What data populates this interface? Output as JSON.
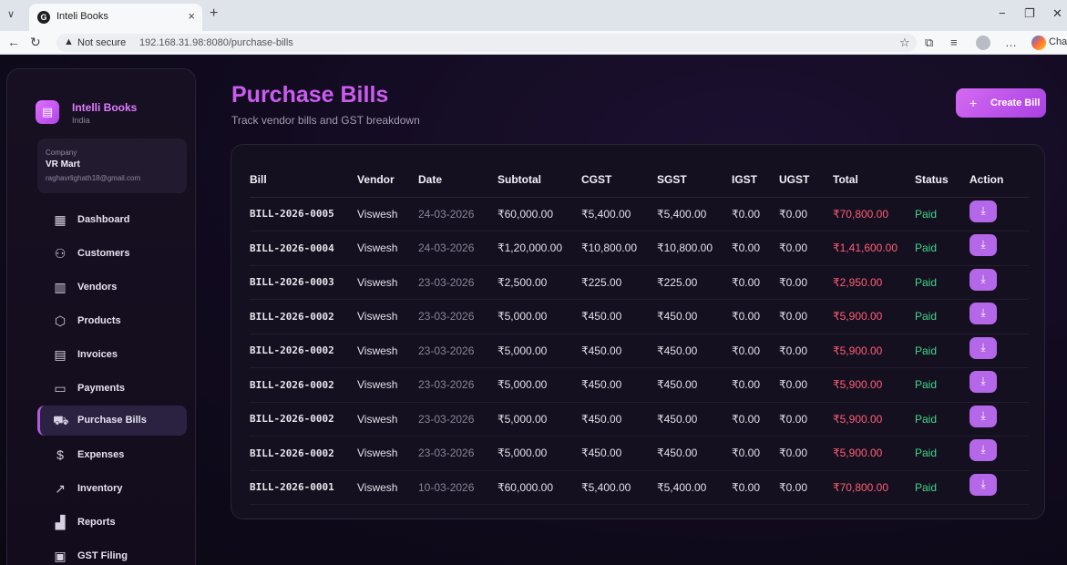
{
  "browser": {
    "tab_title": "Inteli Books",
    "tab_close": "×",
    "new_tab": "+",
    "not_secure": "Not secure",
    "url": "192.168.31.98:8080/purchase-bills",
    "chat": "Chat"
  },
  "sidebar": {
    "brand_name": "Intelli Books",
    "brand_sub": "India",
    "company_label": "Company",
    "company_name": "VR Mart",
    "company_email": "raghavrlighath18@gmail.com",
    "items": [
      {
        "label": "Dashboard",
        "icon": "grid-icon"
      },
      {
        "label": "Customers",
        "icon": "users-icon"
      },
      {
        "label": "Vendors",
        "icon": "building-icon"
      },
      {
        "label": "Products",
        "icon": "box-icon"
      },
      {
        "label": "Invoices",
        "icon": "document-icon"
      },
      {
        "label": "Payments",
        "icon": "card-icon"
      },
      {
        "label": "Purchase Bills",
        "icon": "cart-icon"
      },
      {
        "label": "Expenses",
        "icon": "dollar-icon"
      },
      {
        "label": "Inventory",
        "icon": "trend-icon"
      },
      {
        "label": "Reports",
        "icon": "bar-chart-icon"
      },
      {
        "label": "GST Filing",
        "icon": "calculator-icon"
      }
    ],
    "active": "Purchase Bills"
  },
  "header": {
    "title": "Purchase Bills",
    "subtitle": "Track vendor bills and GST breakdown",
    "create_button": "Create Bill"
  },
  "table": {
    "columns": [
      "Bill",
      "Vendor",
      "Date",
      "Subtotal",
      "CGST",
      "SGST",
      "IGST",
      "UGST",
      "Total",
      "Status",
      "Action"
    ],
    "rows": [
      {
        "bill": "BILL-2026-0005",
        "vendor": "Viswesh",
        "date": "24-03-2026",
        "subtotal": "₹60,000.00",
        "cgst": "₹5,400.00",
        "sgst": "₹5,400.00",
        "igst": "₹0.00",
        "ugst": "₹0.00",
        "total": "₹70,800.00",
        "status": "Paid"
      },
      {
        "bill": "BILL-2026-0004",
        "vendor": "Viswesh",
        "date": "24-03-2026",
        "subtotal": "₹1,20,000.00",
        "cgst": "₹10,800.00",
        "sgst": "₹10,800.00",
        "igst": "₹0.00",
        "ugst": "₹0.00",
        "total": "₹1,41,600.00",
        "status": "Paid"
      },
      {
        "bill": "BILL-2026-0003",
        "vendor": "Viswesh",
        "date": "23-03-2026",
        "subtotal": "₹2,500.00",
        "cgst": "₹225.00",
        "sgst": "₹225.00",
        "igst": "₹0.00",
        "ugst": "₹0.00",
        "total": "₹2,950.00",
        "status": "Paid"
      },
      {
        "bill": "BILL-2026-0002",
        "vendor": "Viswesh",
        "date": "23-03-2026",
        "subtotal": "₹5,000.00",
        "cgst": "₹450.00",
        "sgst": "₹450.00",
        "igst": "₹0.00",
        "ugst": "₹0.00",
        "total": "₹5,900.00",
        "status": "Paid"
      },
      {
        "bill": "BILL-2026-0002",
        "vendor": "Viswesh",
        "date": "23-03-2026",
        "subtotal": "₹5,000.00",
        "cgst": "₹450.00",
        "sgst": "₹450.00",
        "igst": "₹0.00",
        "ugst": "₹0.00",
        "total": "₹5,900.00",
        "status": "Paid"
      },
      {
        "bill": "BILL-2026-0002",
        "vendor": "Viswesh",
        "date": "23-03-2026",
        "subtotal": "₹5,000.00",
        "cgst": "₹450.00",
        "sgst": "₹450.00",
        "igst": "₹0.00",
        "ugst": "₹0.00",
        "total": "₹5,900.00",
        "status": "Paid"
      },
      {
        "bill": "BILL-2026-0002",
        "vendor": "Viswesh",
        "date": "23-03-2026",
        "subtotal": "₹5,000.00",
        "cgst": "₹450.00",
        "sgst": "₹450.00",
        "igst": "₹0.00",
        "ugst": "₹0.00",
        "total": "₹5,900.00",
        "status": "Paid"
      },
      {
        "bill": "BILL-2026-0002",
        "vendor": "Viswesh",
        "date": "23-03-2026",
        "subtotal": "₹5,000.00",
        "cgst": "₹450.00",
        "sgst": "₹450.00",
        "igst": "₹0.00",
        "ugst": "₹0.00",
        "total": "₹5,900.00",
        "status": "Paid"
      },
      {
        "bill": "BILL-2026-0001",
        "vendor": "Viswesh",
        "date": "10-03-2026",
        "subtotal": "₹60,000.00",
        "cgst": "₹5,400.00",
        "sgst": "₹5,400.00",
        "igst": "₹0.00",
        "ugst": "₹0.00",
        "total": "₹70,800.00",
        "status": "Paid"
      }
    ]
  },
  "colors": {
    "accent": "#c65cf0",
    "total": "#ff5e78",
    "status_paid": "#3fd78a",
    "action_button": "#b467e8"
  }
}
